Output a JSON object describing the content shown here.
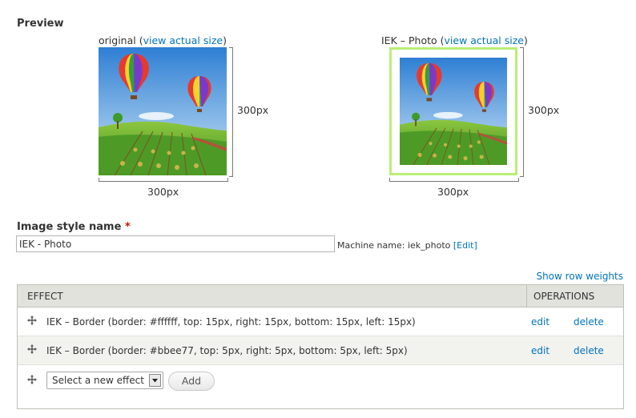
{
  "preview": {
    "title": "Preview",
    "original": {
      "label": "original",
      "link": "view actual size",
      "width_label": "300px",
      "height_label": "300px"
    },
    "styled": {
      "label": "IEK – Photo",
      "link": "view actual size",
      "width_label": "300px",
      "height_label": "300px"
    },
    "paren_open": "(",
    "paren_close": ")"
  },
  "form": {
    "name_label": "Image style name",
    "required_marker": "*",
    "name_value": "IEK - Photo",
    "machine_name_label": "Machine name: iek_photo",
    "machine_edit": "[Edit]"
  },
  "effects": {
    "show_row_weights": "Show row weights",
    "headers": {
      "effect": "EFFECT",
      "operations": "OPERATIONS"
    },
    "rows": [
      {
        "text": "IEK – Border (border: #ffffff, top: 15px, right: 15px, bottom: 15px, left: 15px)",
        "edit": "edit",
        "delete": "delete"
      },
      {
        "text": "IEK – Border (border: #bbee77, top: 5px, right: 5px, bottom: 5px, left: 5px)",
        "edit": "edit",
        "delete": "delete"
      }
    ],
    "new_effect_select": "Select a new effect",
    "add_button": "Add"
  },
  "colors": {
    "link": "#0074bd",
    "styled_border": "#bbee77",
    "required": "#cc1100",
    "table_header_bg": "#e1e2dc"
  },
  "icons": {
    "drag_handle": "drag-handle-icon",
    "select_arrow": "chevron-down-icon"
  }
}
